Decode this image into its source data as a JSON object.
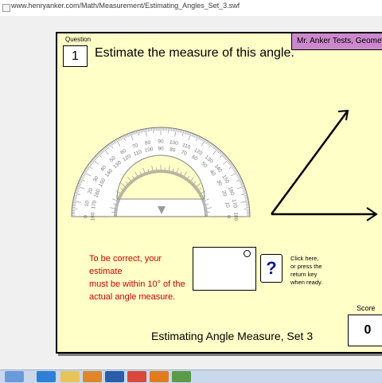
{
  "browser": {
    "url": "www.henryanker.com/Math/Measurement/Estimating_Angles_Set_3.swf"
  },
  "quiz": {
    "question_label": "Question",
    "question_number": "1",
    "prompt": "Estimate the measure of this angle.",
    "brand": "Mr. Anker Tests, Geometry",
    "note_line1": "To be correct, your estimate",
    "note_line2": "must be within 10° of the",
    "note_line3": "actual angle measure.",
    "answer_value": "",
    "help_label": "?",
    "hint_line1": "Click here,",
    "hint_line2": "or press the",
    "hint_line3": "return key",
    "hint_line4": "when ready.",
    "score_label": "Score",
    "score_value": "0",
    "footer_title": "Estimating Angle Measure, Set 3"
  },
  "protractor": {
    "outer_labels": [
      "0",
      "10",
      "20",
      "30",
      "40",
      "50",
      "60",
      "70",
      "80",
      "90",
      "100",
      "110",
      "120",
      "130",
      "140",
      "150",
      "160",
      "170",
      "180"
    ],
    "inner_labels": [
      "180",
      "170",
      "160",
      "150",
      "140",
      "130",
      "120",
      "110",
      "100",
      "90",
      "80",
      "70",
      "60",
      "50",
      "40",
      "30",
      "20",
      "10",
      "0"
    ]
  },
  "taskbar": {
    "icons": [
      "ie-icon",
      "explorer-icon",
      "media-icon",
      "word-icon",
      "chrome-icon",
      "firefox-icon",
      "app-icon"
    ]
  },
  "colors": {
    "stage_bg": "#ffffc8",
    "brand_bg": "#cc88cc",
    "note_text": "#cc0000",
    "help_q": "#0a1a96"
  }
}
